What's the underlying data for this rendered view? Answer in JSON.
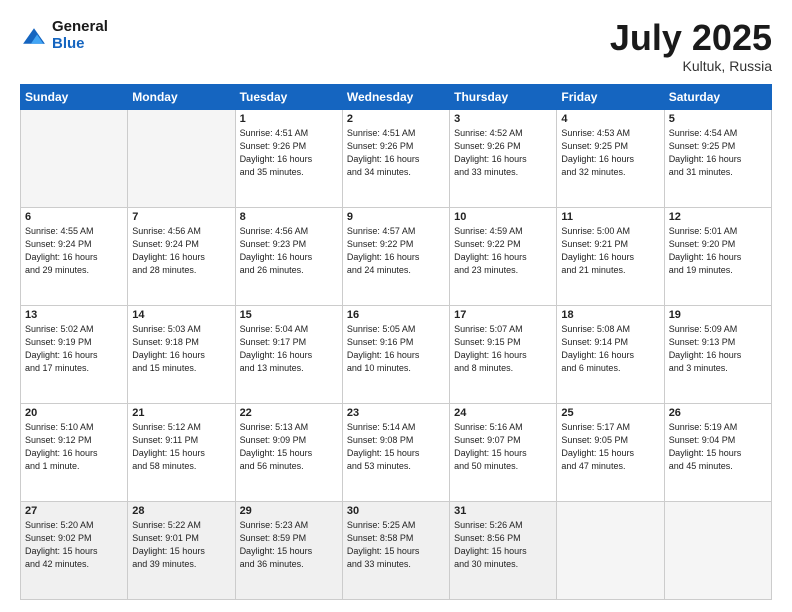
{
  "logo": {
    "line1": "General",
    "line2": "Blue"
  },
  "title": "July 2025",
  "location": "Kultuk, Russia",
  "days_header": [
    "Sunday",
    "Monday",
    "Tuesday",
    "Wednesday",
    "Thursday",
    "Friday",
    "Saturday"
  ],
  "weeks": [
    [
      {
        "day": "",
        "info": ""
      },
      {
        "day": "",
        "info": ""
      },
      {
        "day": "1",
        "info": "Sunrise: 4:51 AM\nSunset: 9:26 PM\nDaylight: 16 hours\nand 35 minutes."
      },
      {
        "day": "2",
        "info": "Sunrise: 4:51 AM\nSunset: 9:26 PM\nDaylight: 16 hours\nand 34 minutes."
      },
      {
        "day": "3",
        "info": "Sunrise: 4:52 AM\nSunset: 9:26 PM\nDaylight: 16 hours\nand 33 minutes."
      },
      {
        "day": "4",
        "info": "Sunrise: 4:53 AM\nSunset: 9:25 PM\nDaylight: 16 hours\nand 32 minutes."
      },
      {
        "day": "5",
        "info": "Sunrise: 4:54 AM\nSunset: 9:25 PM\nDaylight: 16 hours\nand 31 minutes."
      }
    ],
    [
      {
        "day": "6",
        "info": "Sunrise: 4:55 AM\nSunset: 9:24 PM\nDaylight: 16 hours\nand 29 minutes."
      },
      {
        "day": "7",
        "info": "Sunrise: 4:56 AM\nSunset: 9:24 PM\nDaylight: 16 hours\nand 28 minutes."
      },
      {
        "day": "8",
        "info": "Sunrise: 4:56 AM\nSunset: 9:23 PM\nDaylight: 16 hours\nand 26 minutes."
      },
      {
        "day": "9",
        "info": "Sunrise: 4:57 AM\nSunset: 9:22 PM\nDaylight: 16 hours\nand 24 minutes."
      },
      {
        "day": "10",
        "info": "Sunrise: 4:59 AM\nSunset: 9:22 PM\nDaylight: 16 hours\nand 23 minutes."
      },
      {
        "day": "11",
        "info": "Sunrise: 5:00 AM\nSunset: 9:21 PM\nDaylight: 16 hours\nand 21 minutes."
      },
      {
        "day": "12",
        "info": "Sunrise: 5:01 AM\nSunset: 9:20 PM\nDaylight: 16 hours\nand 19 minutes."
      }
    ],
    [
      {
        "day": "13",
        "info": "Sunrise: 5:02 AM\nSunset: 9:19 PM\nDaylight: 16 hours\nand 17 minutes."
      },
      {
        "day": "14",
        "info": "Sunrise: 5:03 AM\nSunset: 9:18 PM\nDaylight: 16 hours\nand 15 minutes."
      },
      {
        "day": "15",
        "info": "Sunrise: 5:04 AM\nSunset: 9:17 PM\nDaylight: 16 hours\nand 13 minutes."
      },
      {
        "day": "16",
        "info": "Sunrise: 5:05 AM\nSunset: 9:16 PM\nDaylight: 16 hours\nand 10 minutes."
      },
      {
        "day": "17",
        "info": "Sunrise: 5:07 AM\nSunset: 9:15 PM\nDaylight: 16 hours\nand 8 minutes."
      },
      {
        "day": "18",
        "info": "Sunrise: 5:08 AM\nSunset: 9:14 PM\nDaylight: 16 hours\nand 6 minutes."
      },
      {
        "day": "19",
        "info": "Sunrise: 5:09 AM\nSunset: 9:13 PM\nDaylight: 16 hours\nand 3 minutes."
      }
    ],
    [
      {
        "day": "20",
        "info": "Sunrise: 5:10 AM\nSunset: 9:12 PM\nDaylight: 16 hours\nand 1 minute."
      },
      {
        "day": "21",
        "info": "Sunrise: 5:12 AM\nSunset: 9:11 PM\nDaylight: 15 hours\nand 58 minutes."
      },
      {
        "day": "22",
        "info": "Sunrise: 5:13 AM\nSunset: 9:09 PM\nDaylight: 15 hours\nand 56 minutes."
      },
      {
        "day": "23",
        "info": "Sunrise: 5:14 AM\nSunset: 9:08 PM\nDaylight: 15 hours\nand 53 minutes."
      },
      {
        "day": "24",
        "info": "Sunrise: 5:16 AM\nSunset: 9:07 PM\nDaylight: 15 hours\nand 50 minutes."
      },
      {
        "day": "25",
        "info": "Sunrise: 5:17 AM\nSunset: 9:05 PM\nDaylight: 15 hours\nand 47 minutes."
      },
      {
        "day": "26",
        "info": "Sunrise: 5:19 AM\nSunset: 9:04 PM\nDaylight: 15 hours\nand 45 minutes."
      }
    ],
    [
      {
        "day": "27",
        "info": "Sunrise: 5:20 AM\nSunset: 9:02 PM\nDaylight: 15 hours\nand 42 minutes."
      },
      {
        "day": "28",
        "info": "Sunrise: 5:22 AM\nSunset: 9:01 PM\nDaylight: 15 hours\nand 39 minutes."
      },
      {
        "day": "29",
        "info": "Sunrise: 5:23 AM\nSunset: 8:59 PM\nDaylight: 15 hours\nand 36 minutes."
      },
      {
        "day": "30",
        "info": "Sunrise: 5:25 AM\nSunset: 8:58 PM\nDaylight: 15 hours\nand 33 minutes."
      },
      {
        "day": "31",
        "info": "Sunrise: 5:26 AM\nSunset: 8:56 PM\nDaylight: 15 hours\nand 30 minutes."
      },
      {
        "day": "",
        "info": ""
      },
      {
        "day": "",
        "info": ""
      }
    ]
  ]
}
